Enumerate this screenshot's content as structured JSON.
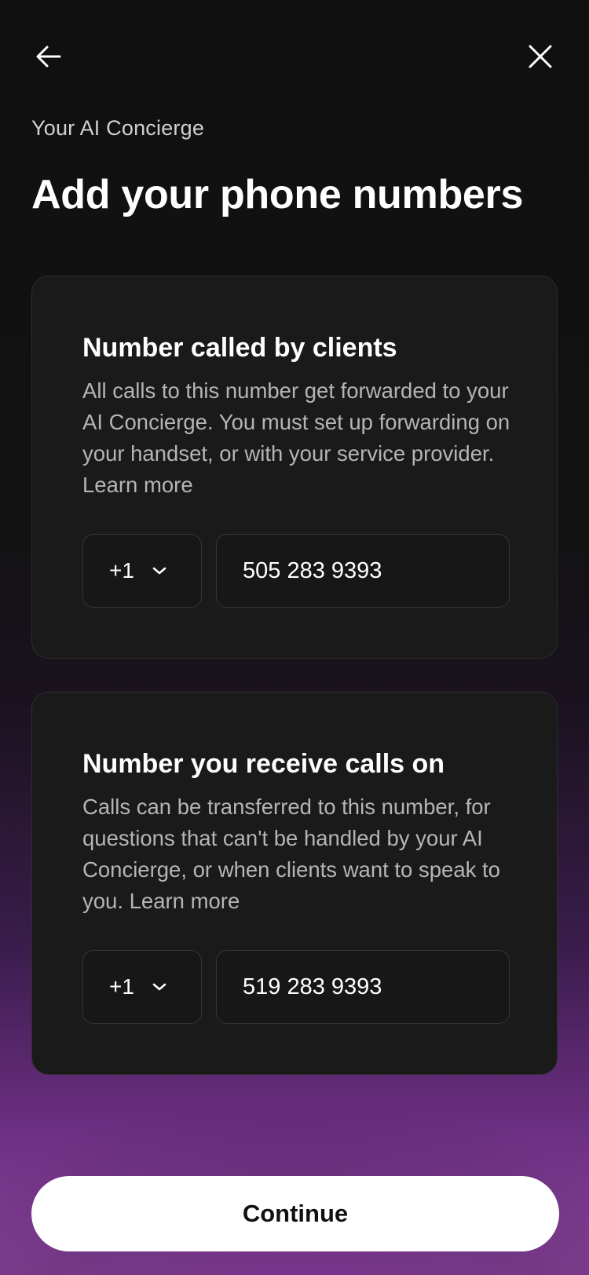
{
  "header": {
    "back_icon": "arrow-left-icon",
    "close_icon": "close-icon"
  },
  "eyebrow": "Your AI Concierge",
  "title": "Add your phone numbers",
  "cards": [
    {
      "title": "Number called by clients",
      "description": "All calls to this number get forwarded to your AI Concierge. You must set up forwarding on your handset, or with your service provider.",
      "learn_more": "Learn more",
      "country_code": "+1",
      "phone_number": "505 283 9393"
    },
    {
      "title": "Number you receive calls on",
      "description": "Calls can be transferred to this number, for questions that can't be handled by your AI Concierge, or when clients want to speak to you.",
      "learn_more": "Learn more",
      "country_code": "+1",
      "phone_number": "519 283 9393"
    }
  ],
  "continue_label": "Continue",
  "colors": {
    "card_background": "#1a1a1a",
    "background_top": "#101010",
    "background_bottom": "#8f46a0",
    "button_background": "#ffffff"
  }
}
